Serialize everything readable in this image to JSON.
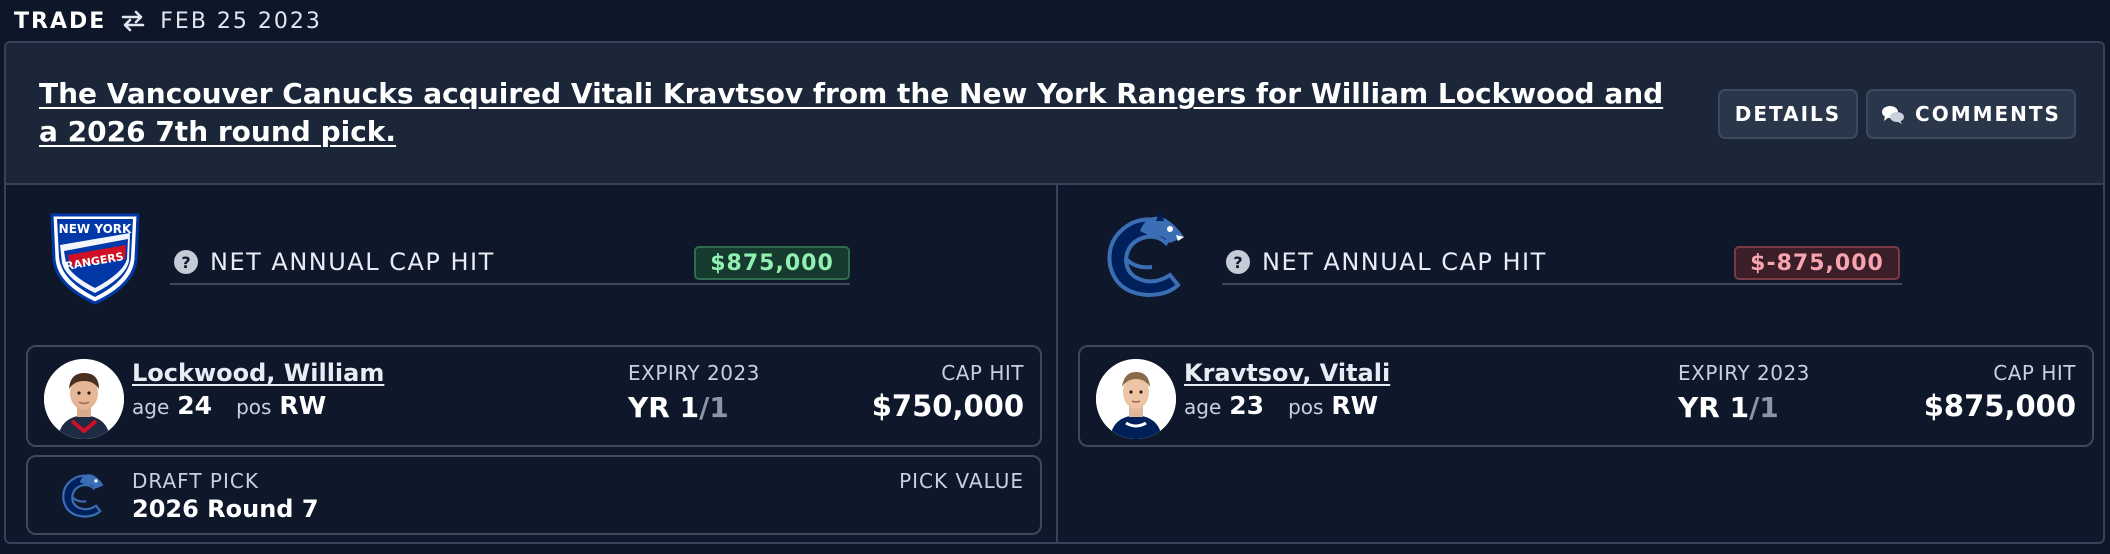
{
  "header": {
    "kind": "TRADE",
    "date": "FEB 25 2023"
  },
  "trade": {
    "headline": "The Vancouver Canucks acquired Vitali Kravtsov from the New York Rangers for William Lockwood and a 2026 7th round pick.",
    "details_label": "DETAILS",
    "comments_label": "COMMENTS"
  },
  "left": {
    "team_logo": "new-york-rangers-logo",
    "logo_text": [
      "NEW YORK",
      "RANGERS"
    ],
    "cap_label": "NET ANNUAL CAP HIT",
    "cap_value": "$875,000",
    "player": {
      "name": "Lockwood, William",
      "age_label": "age",
      "age": "24",
      "pos_label": "pos",
      "pos": "RW",
      "expiry": "EXPIRY 2023",
      "yr_prefix": "YR 1",
      "yr_suffix": "/1",
      "cap_label": "CAP HIT",
      "cap_value": "$750,000"
    },
    "pick": {
      "label": "DRAFT PICK",
      "value": "2026 Round 7",
      "value_label": "PICK VALUE"
    }
  },
  "right": {
    "team_logo": "vancouver-canucks-logo",
    "cap_label": "NET ANNUAL CAP HIT",
    "cap_value": "$-875,000",
    "player": {
      "name": "Kravtsov, Vitali",
      "age_label": "age",
      "age": "23",
      "pos_label": "pos",
      "pos": "RW",
      "expiry": "EXPIRY 2023",
      "yr_prefix": "YR 1",
      "yr_suffix": "/1",
      "cap_label": "CAP HIT",
      "cap_value": "$875,000"
    }
  },
  "colors": {
    "background": "#0e1729",
    "header_bg": "#1b2639",
    "positive": "#8ff0b2",
    "negative": "#f6a4b0",
    "rangers_blue": "#0038a8",
    "rangers_red": "#ce1126",
    "canucks_blue": "#00205b"
  }
}
